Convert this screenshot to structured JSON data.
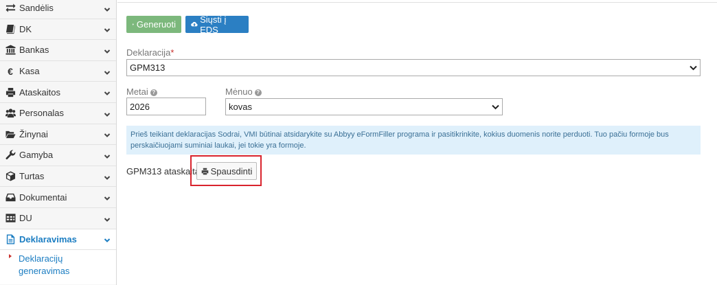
{
  "sidebar": {
    "items": [
      {
        "label": "Sandėlis",
        "icon": "exchange-icon"
      },
      {
        "label": "DK",
        "icon": "book-icon"
      },
      {
        "label": "Bankas",
        "icon": "bank-icon"
      },
      {
        "label": "Kasa",
        "icon": "euro-icon"
      },
      {
        "label": "Ataskaitos",
        "icon": "print-icon"
      },
      {
        "label": "Personalas",
        "icon": "users-icon"
      },
      {
        "label": "Žinynai",
        "icon": "folder-open-icon"
      },
      {
        "label": "Gamyba",
        "icon": "wrench-icon"
      },
      {
        "label": "Turtas",
        "icon": "cube-icon"
      },
      {
        "label": "Dokumentai",
        "icon": "inbox-icon"
      },
      {
        "label": "DU",
        "icon": "table-icon"
      },
      {
        "label": "Deklaravimas",
        "icon": "document-icon"
      }
    ],
    "subitem": {
      "line1": "Deklaracijų",
      "line2": "generavimas"
    }
  },
  "toolbar": {
    "generate_label": "Generuoti",
    "send_label": "Siųsti į EDS"
  },
  "form": {
    "declaration_label": "Deklaracija",
    "declaration_required": "*",
    "declaration_value": "GPM313",
    "year_label": "Metai",
    "year_value": "2026",
    "month_label": "Mėnuo",
    "month_value": "kovas"
  },
  "alert": {
    "text": "Prieš teikiant deklaracijas Sodrai, VMI būtinai atsidarykite su Abbyy eFormFiller programa ir pasitikrinkite, kokius duomenis norite perduoti. Tuo pačiu formoje bus perskaičiuojami suminiai laukai, jei tokie yra formoje."
  },
  "report": {
    "label": "GPM313 ataskaita",
    "print_label": "Spausdinti"
  },
  "colors": {
    "accent": "#1b7dc2",
    "generate_button": "#7cb87c",
    "send_button": "#2b7fc3",
    "highlight": "#d9232d",
    "alert_bg": "#dff0fb"
  }
}
